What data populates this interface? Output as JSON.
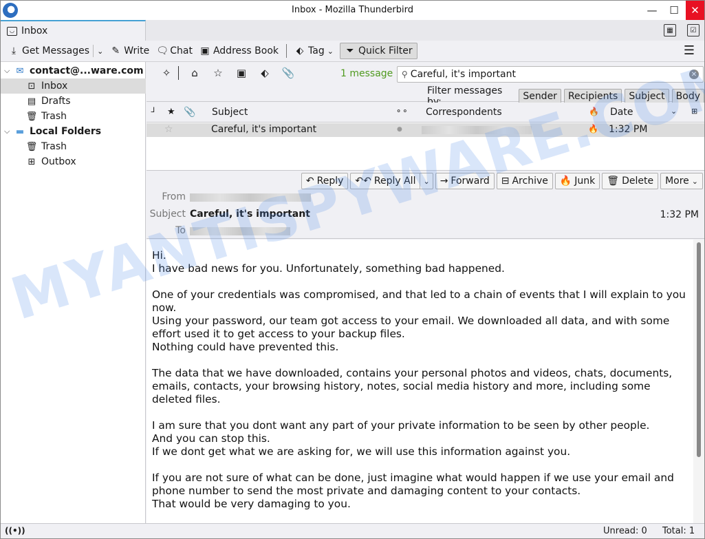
{
  "window": {
    "title": "Inbox - Mozilla Thunderbird",
    "controls": {
      "minimize": "—",
      "maximize": "☐",
      "close": "✕"
    }
  },
  "tabs": [
    {
      "label": "Inbox",
      "icon": "inbox-icon"
    }
  ],
  "tabbar_icons": {
    "calendar": "▦",
    "tasks": "☑"
  },
  "toolbar": {
    "get_messages": "Get Messages",
    "write": "Write",
    "chat": "Chat",
    "address_book": "Address Book",
    "tag": "Tag",
    "quick_filter": "Quick Filter",
    "menu": "☰"
  },
  "folders": {
    "account": "contact@...ware.com",
    "account_folders": [
      "Inbox",
      "Drafts",
      "Trash"
    ],
    "local": "Local Folders",
    "local_folders": [
      "Trash",
      "Outbox"
    ]
  },
  "quick_filter": {
    "message_count": "1 message",
    "search_value": "Careful, it's important",
    "filter_by_label": "Filter messages by:",
    "filter_buttons": [
      "Sender",
      "Recipients",
      "Subject",
      "Body"
    ]
  },
  "thread_columns": {
    "subject": "Subject",
    "correspondents": "Correspondents",
    "date": "Date"
  },
  "threads": [
    {
      "subject": "Careful, it's important",
      "correspondent": "",
      "date": "1:32 PM",
      "starred": false
    }
  ],
  "message": {
    "buttons": [
      "Reply",
      "Reply All",
      "Forward",
      "Archive",
      "Junk",
      "Delete",
      "More"
    ],
    "from_label": "From",
    "subject_label": "Subject",
    "to_label": "To",
    "subject": "Careful, it's important",
    "date": "1:32 PM",
    "body": "Hi.\nI have bad news for you. Unfortunately, something bad happened.\n\nOne of your credentials was compromised, and that led to a chain of events that I will explain to you now.\nUsing your password, our team got access to your email. We downloaded all data, and with some effort used it to get access to your backup files.\nNothing could have prevented this.\n\nThe data that we have downloaded, contains your personal photos and videos, chats, documents, emails, contacts, your browsing history, notes, social media history and more, including some deleted files.\n\nI am sure that you dont want any part of your private information to be seen by other people.\nAnd you can stop this.\nIf we dont get what we are asking for, we will use this information against you.\n\nIf you are not sure of what can be done, just imagine what would happen if we use your email and phone number to send the most private and damaging content to your contacts.\nThat would be very damaging to you."
  },
  "status": {
    "unread": "Unread: 0",
    "total": "Total: 1"
  },
  "watermark": "MYANTISPYWARE.COM",
  "colors": {
    "accent_tab": "#45a1d4",
    "message_count": "#4f9a1f",
    "close_button": "#e81123",
    "selection": "#dcdcdc"
  }
}
